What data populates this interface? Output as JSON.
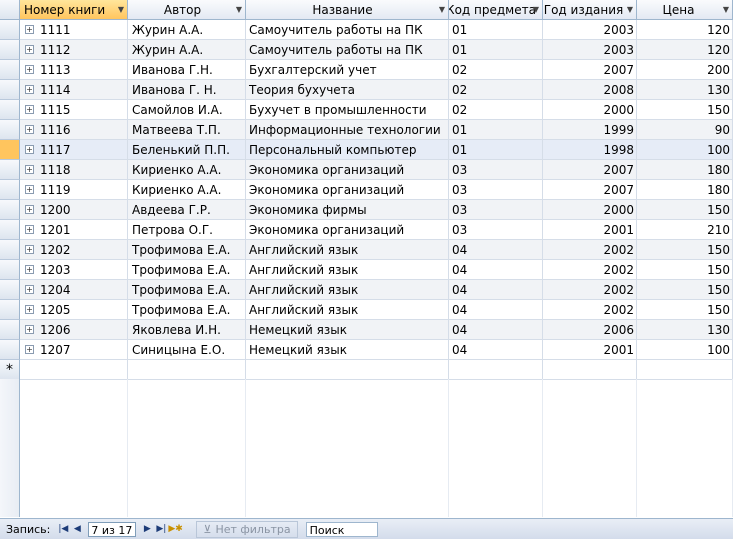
{
  "columns": [
    "Номер книги",
    "Автор",
    "Название",
    "Код предмета",
    "Год издания",
    "Цена"
  ],
  "rows": [
    {
      "id": "1111",
      "author": "Журин А.А.",
      "title": "Самоучитель работы на ПК",
      "code": "01",
      "year": "2003",
      "price": "120"
    },
    {
      "id": "1112",
      "author": "Журин А.А.",
      "title": "Самоучитель работы на ПК",
      "code": "01",
      "year": "2003",
      "price": "120"
    },
    {
      "id": "1113",
      "author": "Иванова Г.Н.",
      "title": "Бухгалтерский учет",
      "code": "02",
      "year": "2007",
      "price": "200"
    },
    {
      "id": "1114",
      "author": "Иванова Г. Н.",
      "title": "Теория бухучета",
      "code": "02",
      "year": "2008",
      "price": "130"
    },
    {
      "id": "1115",
      "author": "Самойлов И.А.",
      "title": "Бухучет в промышленности",
      "code": "02",
      "year": "2000",
      "price": "150"
    },
    {
      "id": "1116",
      "author": "Матвеева Т.П.",
      "title": "Информационные технологии",
      "code": "01",
      "year": "1999",
      "price": "90"
    },
    {
      "id": "1117",
      "author": "Беленький П.П.",
      "title": "Персональный компьютер",
      "code": "01",
      "year": "1998",
      "price": "100"
    },
    {
      "id": "1118",
      "author": "Кириенко А.А.",
      "title": "Экономика организаций",
      "code": "03",
      "year": "2007",
      "price": "180"
    },
    {
      "id": "1119",
      "author": "Кириенко А.А.",
      "title": "Экономика организаций",
      "code": "03",
      "year": "2007",
      "price": "180"
    },
    {
      "id": "1200",
      "author": "Авдеева Г.Р.",
      "title": "Экономика фирмы",
      "code": "03",
      "year": "2000",
      "price": "150"
    },
    {
      "id": "1201",
      "author": "Петрова О.Г.",
      "title": "Экономика организаций",
      "code": "03",
      "year": "2001",
      "price": "210"
    },
    {
      "id": "1202",
      "author": "Трофимова Е.А.",
      "title": "Английский язык",
      "code": "04",
      "year": "2002",
      "price": "150"
    },
    {
      "id": "1203",
      "author": "Трофимова Е.А.",
      "title": "Английский язык",
      "code": "04",
      "year": "2002",
      "price": "150"
    },
    {
      "id": "1204",
      "author": "Трофимова Е.А.",
      "title": "Английский язык",
      "code": "04",
      "year": "2002",
      "price": "150"
    },
    {
      "id": "1205",
      "author": "Трофимова Е.А.",
      "title": "Английский язык",
      "code": "04",
      "year": "2002",
      "price": "150"
    },
    {
      "id": "1206",
      "author": "Яковлева И.Н.",
      "title": "Немецкий язык",
      "code": "04",
      "year": "2006",
      "price": "130"
    },
    {
      "id": "1207",
      "author": "Синицына Е.О.",
      "title": "Немецкий язык",
      "code": "04",
      "year": "2001",
      "price": "100"
    }
  ],
  "current_row_index": 6,
  "new_row_marker": "*",
  "expander_symbol": "+",
  "status": {
    "record_label": "Запись:",
    "position": "7 из 17",
    "filter_label": "Нет фильтра",
    "search_label": "Поиск",
    "icons": [
      "first-record-icon",
      "prev-record-icon",
      "next-record-icon",
      "last-record-icon",
      "new-record-icon",
      "filter-icon"
    ]
  },
  "colors": {
    "header_active": "#ffc55e",
    "grid_line": "#d5dde8",
    "current_row": "#e6ecf7",
    "alt_row": "#f1f3f6"
  }
}
